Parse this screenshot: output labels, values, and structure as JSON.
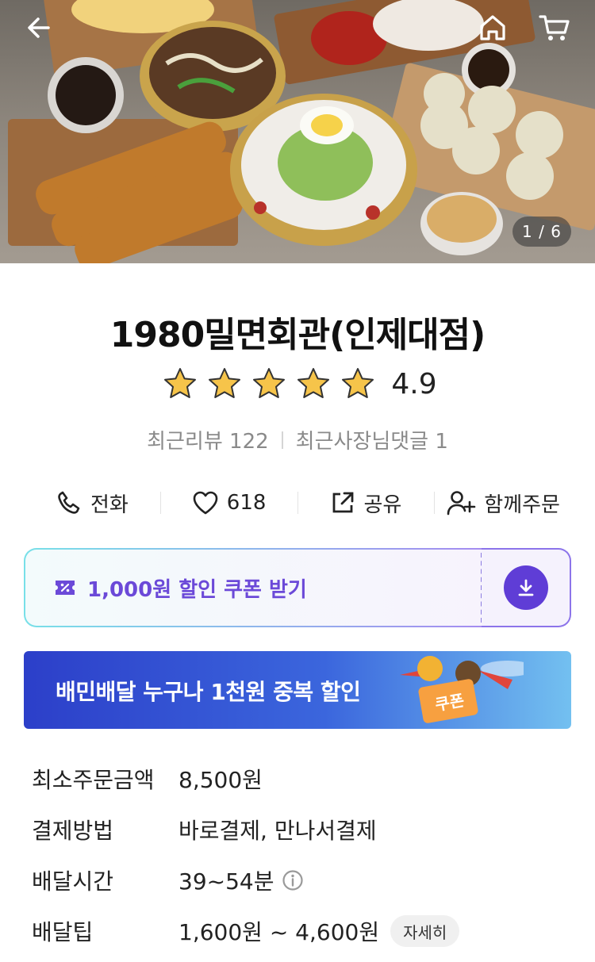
{
  "hero": {
    "pager": "1 / 6",
    "icons": {
      "back": "arrow-left-icon",
      "home": "home-icon",
      "cart": "cart-icon"
    }
  },
  "store": {
    "name": "1980밀면회관(인제대점)",
    "rating": "4.9",
    "stars": 5,
    "recent_reviews_label": "최근리뷰 122",
    "recent_owner_replies_label": "최근사장님댓글 1"
  },
  "actions": [
    {
      "icon": "phone-icon",
      "label": "전화"
    },
    {
      "icon": "heart-icon",
      "label": "618"
    },
    {
      "icon": "share-icon",
      "label": "공유"
    },
    {
      "icon": "add-user-icon",
      "label": "함께주문"
    }
  ],
  "coupon": {
    "label": "1,000원 할인 쿠폰 받기",
    "icon": "coupon-icon",
    "download_icon": "download-icon"
  },
  "banner": {
    "text": "배민배달 누구나 1천원 중복 할인",
    "badge": "쿠폰"
  },
  "info": {
    "min_order_label": "최소주문금액",
    "min_order_value": "8,500원",
    "payment_label": "결제방법",
    "payment_value": "바로결제, 만나서결제",
    "delivery_time_label": "배달시간",
    "delivery_time_value": "39~54분",
    "delivery_tip_label": "배달팁",
    "delivery_tip_value": "1,600원 ~ 4,600원",
    "detail_button": "자세히"
  },
  "colors": {
    "coupon_text": "#6b49d8",
    "download_button": "#5f3dd6",
    "banner_start": "#2c3fc9",
    "banner_end": "#73c0f0",
    "star": "#f6c44a"
  }
}
